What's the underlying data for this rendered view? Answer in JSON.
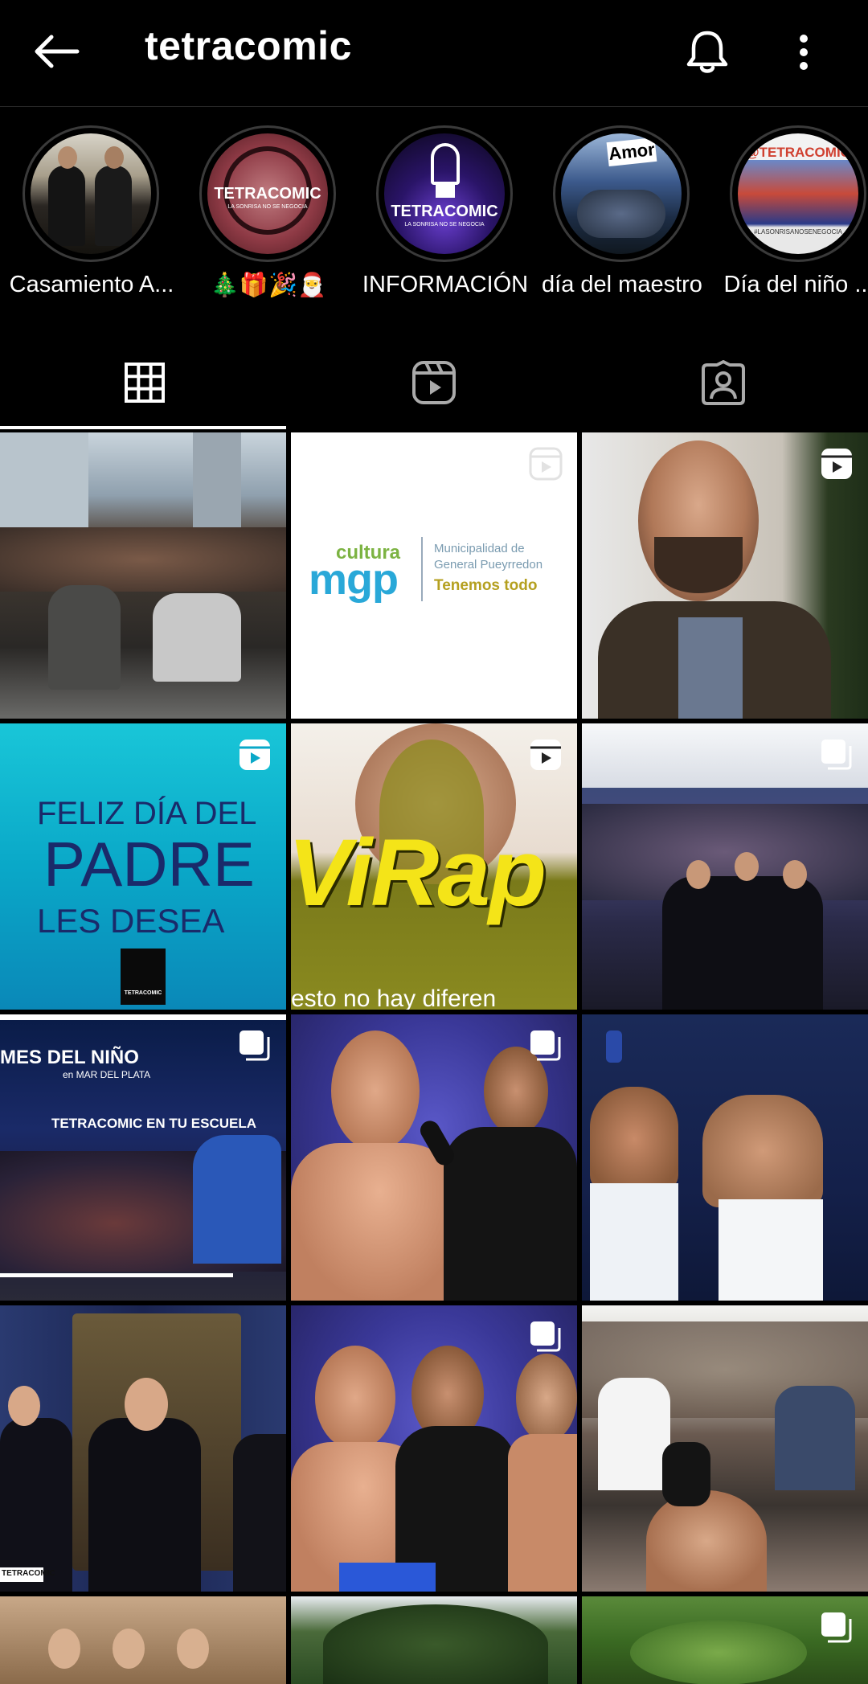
{
  "header": {
    "username": "tetracomic",
    "back_icon": "arrow-left-icon",
    "bell_icon": "bell-icon",
    "more_icon": "more-vertical-icon"
  },
  "highlights": [
    {
      "label": "Casamiento A..."
    },
    {
      "label": "🎄🎁🎉🎅"
    },
    {
      "label": "INFORMACIÓN"
    },
    {
      "label": "día del maestro"
    },
    {
      "label": "Día del niño ..."
    }
  ],
  "highlight_texts": {
    "h2_brand": "TETRACOMIC",
    "h2_sub": "LA SONRISA NO SE NEGOCIA",
    "h3_brand": "TETRACOMIC",
    "h3_sub": "LA SONRISA NO SE NEGOCIA",
    "h4_word": "Amor",
    "h5_handle": "@TETRACOMIC",
    "h5_tag": "#LASONRISANOSENEGOCIA"
  },
  "tabs": [
    {
      "name": "grid",
      "icon": "grid-icon",
      "active": true
    },
    {
      "name": "reels",
      "icon": "reels-icon",
      "active": false
    },
    {
      "name": "tagged",
      "icon": "tagged-user-icon",
      "active": false
    }
  ],
  "posts": {
    "p2_cultura": "cultura",
    "p2_mgp": "mgp",
    "p2_muni1": "Municipalidad de",
    "p2_muni2": "General Pueyrredon",
    "p2_tagline": "Tenemos todo",
    "p4_line1": "FELIZ DÍA DEL",
    "p4_line2": "PADRE",
    "p4_line3": "LES DESEA",
    "p4_logo": "TETRACOMIC",
    "p5_text": "ViRap",
    "p5_bottom": "esto no hay diferen",
    "p7_title": "MES DEL NIÑO",
    "p7_sub": "en MAR DEL PLATA",
    "p7_line": "TETRACOMIC EN TU ESCUELA",
    "p10_logo": "TETRACOMIC"
  },
  "colors": {
    "background": "#000000",
    "text": "#ffffff",
    "ring": "#3a3a3a",
    "divider": "#262626"
  }
}
